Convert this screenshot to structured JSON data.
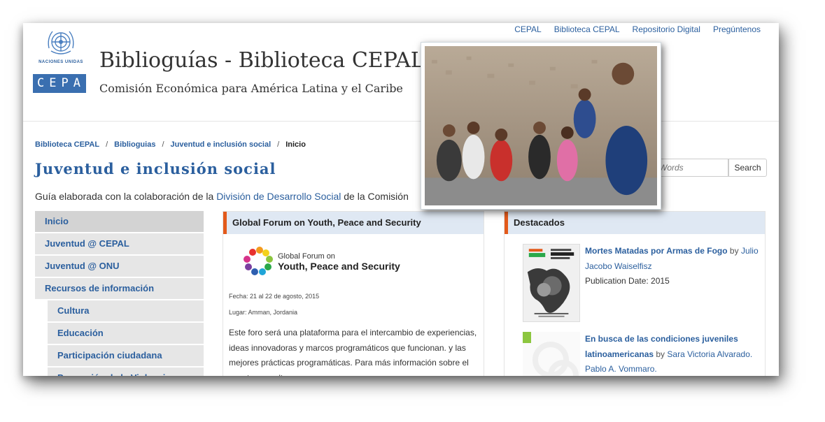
{
  "top_links": [
    "CEPAL",
    "Biblioteca CEPAL",
    "Repositorio Digital",
    "Pregúntenos"
  ],
  "logo": {
    "un_caption": "NACIONES UNIDAS",
    "cepal_text": "CEPAL"
  },
  "site": {
    "title": "Biblioguías - Biblioteca CEPAL",
    "subtitle": "Comisión Económica para América Latina y el Caribe"
  },
  "breadcrumb": {
    "items": [
      "Biblioteca CEPAL",
      "Biblioguias",
      "Juventud e inclusión social"
    ],
    "current": "Inicio",
    "separator": "/"
  },
  "guide": {
    "title": "Juventud e inclusión social",
    "desc_prefix": "Guía elaborada con la colaboración de la ",
    "desc_link": "División de Desarrollo Social",
    "desc_suffix": " de la Comisión"
  },
  "search": {
    "placeholder": "Words",
    "button": "Search"
  },
  "sidebar": {
    "items": [
      {
        "label": "Inicio"
      },
      {
        "label": "Juventud @ CEPAL"
      },
      {
        "label": "Juventud @ ONU"
      },
      {
        "label": "Recursos de información"
      },
      {
        "label": "Cultura"
      },
      {
        "label": "Educación"
      },
      {
        "label": "Participación ciudadana"
      },
      {
        "label": "Promoción de la Violencia"
      }
    ]
  },
  "forum_panel": {
    "heading": "Global Forum on Youth, Peace and Security",
    "logo_line1": "Global Forum on",
    "logo_line2": "Youth, Peace and Security",
    "fecha": "Fecha: 21 al 22 de agosto, 2015",
    "lugar": "Lugar: Amman, Jordania",
    "paragraph": "Este foro será una plataforma para el intercambio de experiencias, ideas innovadoras y marcos programáticos que funcionan. y las mejores prácticas programáticas. Para más información sobre el evento consulte"
  },
  "featured_panel": {
    "heading": "Destacados",
    "books": [
      {
        "title": "Mortes Matadas por Armas de Fogo",
        "by": " by ",
        "author": "Julio Jacobo Waiselfisz",
        "pubdate": "Publication Date: 2015"
      },
      {
        "title": "En busca de las condiciones juveniles latinoamericanas",
        "by": " by ",
        "author": "Sara Victoria Alvarado. Pablo A. Vommaro."
      }
    ]
  },
  "colors": {
    "link": "#2b5f9e",
    "accent": "#e35a1b",
    "panel_head_bg": "#dfe8f3",
    "sidebar_bg": "#e6e6e6",
    "cepal_blue": "#3a6fb0"
  }
}
